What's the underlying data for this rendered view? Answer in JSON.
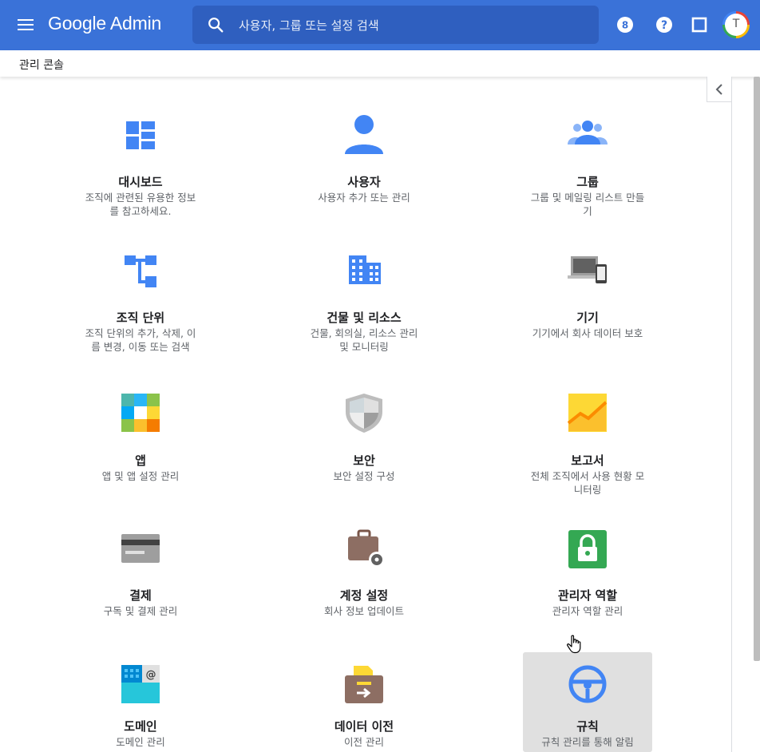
{
  "app": {
    "logo": "Google Admin"
  },
  "search": {
    "placeholder": "사용자, 그룹 또는 설정 검색"
  },
  "header_icons": [
    "apps-count-icon",
    "help-icon",
    "notifications-icon",
    "account-avatar"
  ],
  "avatar": {
    "letter": "T"
  },
  "breadcrumb": {
    "label": "관리 콘솔"
  },
  "cards": [
    {
      "title": "대시보드",
      "desc": "조직에 관련된 유용한 정보를 참고하세요.",
      "icon": "dashboard-icon"
    },
    {
      "title": "사용자",
      "desc": "사용자 추가 또는 관리",
      "icon": "user-icon"
    },
    {
      "title": "그룹",
      "desc": "그룹 및 메일링 리스트 만들기",
      "icon": "groups-icon"
    },
    {
      "title": "조직 단위",
      "desc": "조직 단위의 추가, 삭제, 이름 변경, 이동 또는 검색",
      "icon": "org-unit-icon"
    },
    {
      "title": "건물 및 리소스",
      "desc": "건물, 회의실, 리소스 관리 및 모니터링",
      "icon": "building-icon"
    },
    {
      "title": "기기",
      "desc": "기기에서 회사 데이터 보호",
      "icon": "devices-icon"
    },
    {
      "title": "앱",
      "desc": "앱 및 앱 설정 관리",
      "icon": "apps-icon"
    },
    {
      "title": "보안",
      "desc": "보안 설정 구성",
      "icon": "security-shield-icon"
    },
    {
      "title": "보고서",
      "desc": "전체 조직에서 사용 현황 모니터링",
      "icon": "reports-chart-icon"
    },
    {
      "title": "결제",
      "desc": "구독 및 결제 관리",
      "icon": "billing-card-icon"
    },
    {
      "title": "계정 설정",
      "desc": "회사 정보 업데이트",
      "icon": "account-settings-icon"
    },
    {
      "title": "관리자 역할",
      "desc": "관리자 역할 관리",
      "icon": "admin-roles-lock-icon"
    },
    {
      "title": "도메인",
      "desc": "도메인 관리",
      "icon": "domain-icon"
    },
    {
      "title": "데이터 이전",
      "desc": "이전 관리",
      "icon": "data-migration-icon"
    },
    {
      "title": "규칙",
      "desc": "규칙 관리를 통해 알림",
      "icon": "rules-wheel-icon"
    }
  ],
  "colors": {
    "header": "#3a72d8",
    "search_bg": "#2f5fbf",
    "primary_icon": "#4285f4",
    "hover_card": "#e0e0e0"
  }
}
